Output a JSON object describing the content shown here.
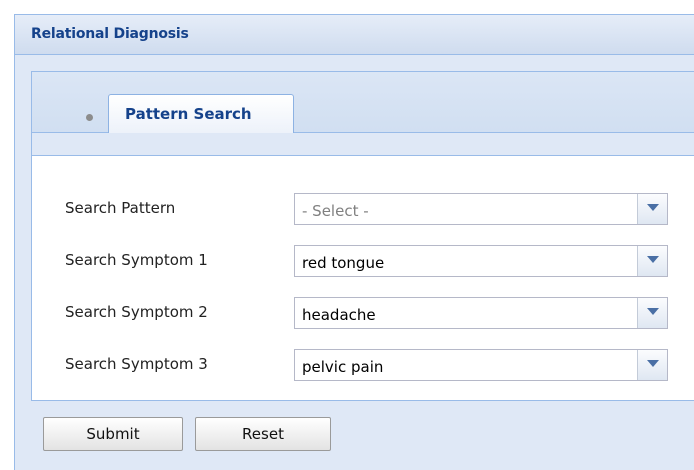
{
  "window": {
    "title": "Relational Diagnosis"
  },
  "tabs": [
    {
      "label": "Pattern Search",
      "active": true
    }
  ],
  "form": {
    "fields": [
      {
        "label": "Search Pattern",
        "value": "- Select -",
        "is_placeholder": true
      },
      {
        "label": "Search Symptom 1",
        "value": "red tongue",
        "is_placeholder": false
      },
      {
        "label": "Search Symptom 2",
        "value": "headache",
        "is_placeholder": false
      },
      {
        "label": "Search Symptom 3",
        "value": "pelvic pain",
        "is_placeholder": false
      }
    ]
  },
  "buttons": {
    "submit_label": "Submit",
    "reset_label": "Reset"
  },
  "icons": {
    "tab_indicator": "dot-icon",
    "dropdown_trigger": "chevron-down-icon"
  },
  "colors": {
    "title_text": "#15428b",
    "panel_border": "#99bbe8",
    "window_background": "#dfe8f6",
    "placeholder_text": "#808080"
  }
}
